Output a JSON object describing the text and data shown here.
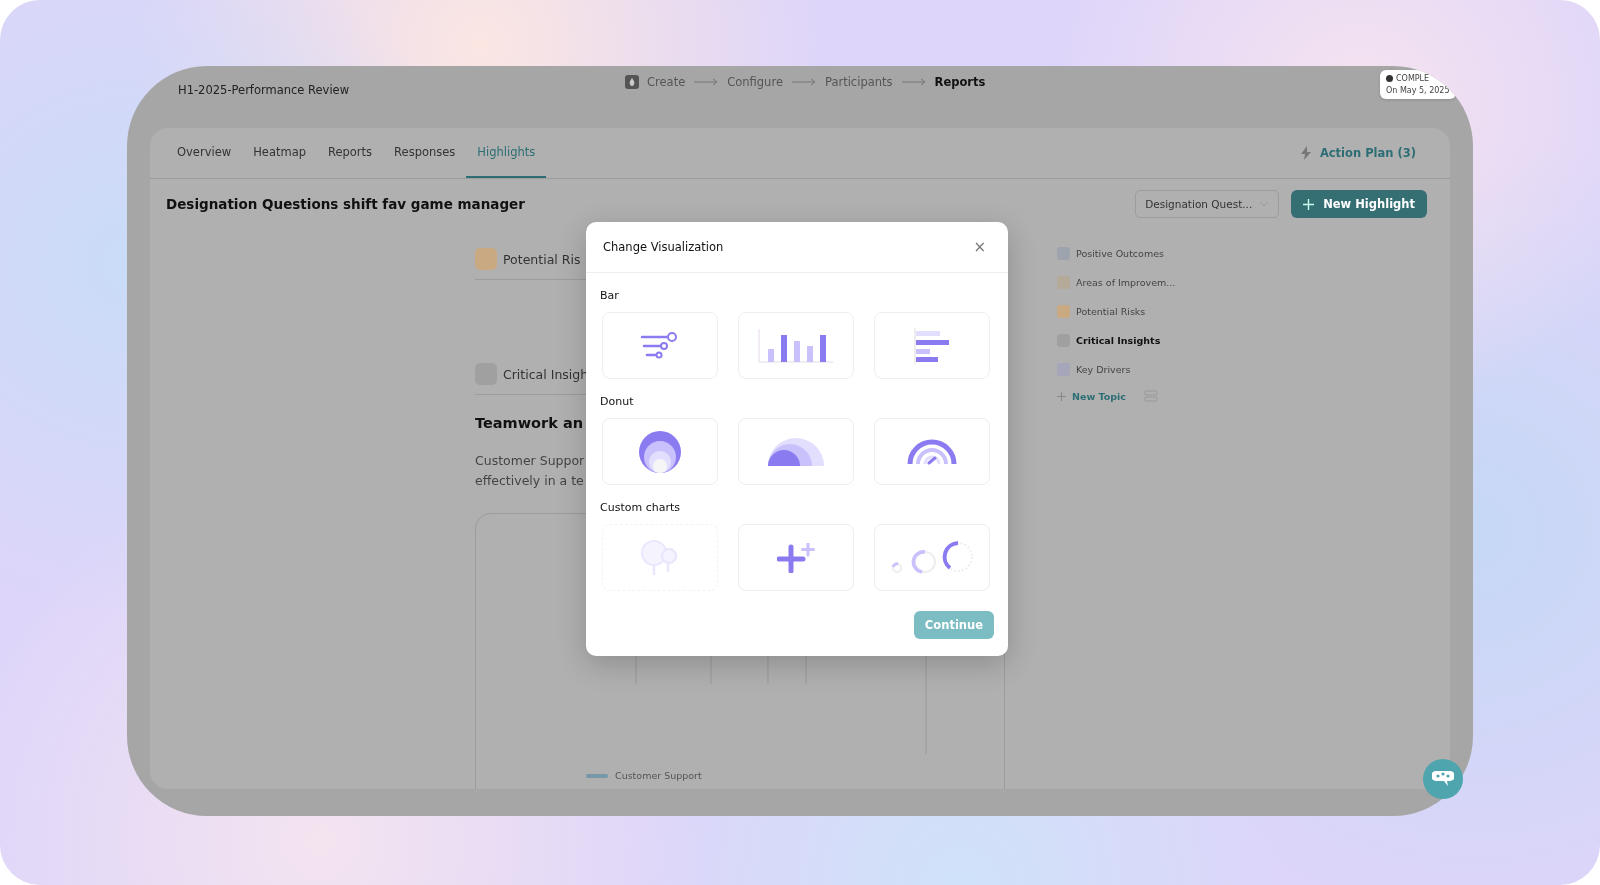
{
  "app": {
    "title": "H1-2025-Performance Review",
    "steps": [
      {
        "label": "Create",
        "current": false,
        "icon": true
      },
      {
        "label": "Configure",
        "current": false,
        "icon": false
      },
      {
        "label": "Participants",
        "current": false,
        "icon": false
      },
      {
        "label": "Reports",
        "current": true,
        "icon": false
      }
    ],
    "status": {
      "label": "COMPLE",
      "date": "On May 5, 2025"
    },
    "tabs": [
      {
        "label": "Overview",
        "selected": false
      },
      {
        "label": "Heatmap",
        "selected": false
      },
      {
        "label": "Reports",
        "selected": false
      },
      {
        "label": "Responses",
        "selected": false
      },
      {
        "label": "Highlights",
        "selected": true
      }
    ],
    "action_plan": "Action Plan (3)",
    "heading": "Designation Questions shift fav game manager",
    "dropdown": {
      "value": "Designation Quest..."
    },
    "new_highlight": "New Highlight",
    "sections": [
      {
        "title": "Potential Ris",
        "color": "#c9a982"
      },
      {
        "title": "Critical Insigh",
        "color": "#a0a0a0"
      }
    ],
    "insight_title": "Teamwork an",
    "insight_text": [
      "Customer Suppor",
      "effectively in a te"
    ],
    "legend": "Customer Support",
    "topics": [
      {
        "label": "Positive Outcomes",
        "color": "#9ea4ae",
        "selected": false
      },
      {
        "label": "Areas of Improvem...",
        "color": "#b5aa98",
        "selected": false
      },
      {
        "label": "Potential Risks",
        "color": "#c9a982",
        "selected": false
      },
      {
        "label": "Critical Insights",
        "color": "#a0a0a0",
        "selected": true
      },
      {
        "label": "Key Drivers",
        "color": "#a6a6ba",
        "selected": false
      }
    ],
    "new_topic": "New Topic"
  },
  "modal": {
    "title": "Change Visualization",
    "close": "×",
    "groups": [
      {
        "label": "Bar",
        "options": [
          {
            "kind": "lollipop",
            "disabled": false
          },
          {
            "kind": "column",
            "disabled": false
          },
          {
            "kind": "horizontal",
            "disabled": false
          }
        ]
      },
      {
        "label": "Donut",
        "options": [
          {
            "kind": "concentric",
            "disabled": false
          },
          {
            "kind": "semi",
            "disabled": false
          },
          {
            "kind": "gauge",
            "disabled": false
          }
        ]
      },
      {
        "label": "Custom charts",
        "options": [
          {
            "kind": "bubble",
            "disabled": true
          },
          {
            "kind": "plus",
            "disabled": false
          },
          {
            "kind": "rings",
            "disabled": false
          }
        ]
      }
    ],
    "continue": {
      "label": "Continue",
      "disabled": true
    }
  }
}
